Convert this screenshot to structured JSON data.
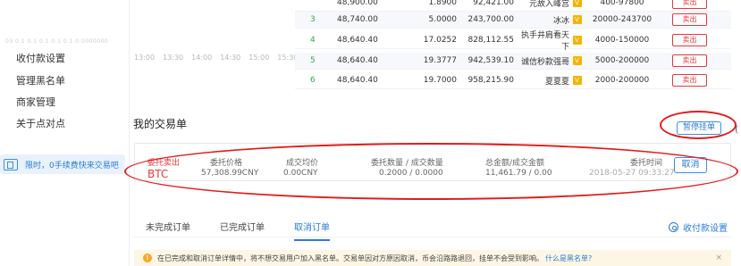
{
  "sidebar": {
    "faint_text": "03 0.1 0.1 0.1 0.1 0.1 0.0000000",
    "items": [
      {
        "label": "收付款设置"
      },
      {
        "label": "管理黑名单"
      },
      {
        "label": "商家管理"
      },
      {
        "label": "关于点对点"
      }
    ],
    "promo": "限时，0手续费快来交易吧"
  },
  "time_axis": [
    "13:00",
    "13:30",
    "14:00",
    "14:30",
    "15:00",
    "15:30"
  ],
  "orders": [
    {
      "no": "",
      "price": "48,900.00",
      "amount": "1.8900",
      "total": "92,421.00",
      "name": "元故入峰宫",
      "badge": "V",
      "range": "400-97800",
      "action": "卖出"
    },
    {
      "no": "3",
      "price": "48,740.00",
      "amount": "5.0000",
      "total": "243,700.00",
      "name": "冰冰",
      "badge": "V",
      "range": "20000-243700",
      "action": "卖出"
    },
    {
      "no": "4",
      "price": "48,640.40",
      "amount": "17.0252",
      "total": "828,112.55",
      "name": "执手井肩看天下",
      "badge": "V",
      "range": "4000-150000",
      "action": "卖出"
    },
    {
      "no": "5",
      "price": "48,640.40",
      "amount": "19.3777",
      "total": "942,539.10",
      "name": "诚信秒款强哥",
      "badge": "V",
      "range": "5000-200000",
      "action": "卖出"
    },
    {
      "no": "6",
      "price": "48,640.40",
      "amount": "19.7000",
      "total": "958,215.90",
      "name": "夏夏夏",
      "badge": "V",
      "range": "2000-200000",
      "action": "卖出"
    }
  ],
  "my_trades": {
    "title": "我的交易单",
    "pause_label": "暂停挂单",
    "headers": {
      "side": "委托卖出",
      "price": "委托价格",
      "avg": "成交均价",
      "qty": "委托数量 / 成交数量",
      "amount": "总金额/成交金额",
      "time": "委托时间"
    },
    "row": {
      "coin": "BTC",
      "price": "57,308.99CNY",
      "avg": "0.00CNY",
      "qty": "0.2000 / 0.0000",
      "amount": "11,461.79 / 0.00",
      "time": "2018-05-27 09:33:27"
    },
    "cancel_label": "取消"
  },
  "tabs": [
    {
      "label": "未完成订单",
      "active": false
    },
    {
      "label": "已完成订单",
      "active": false
    },
    {
      "label": "取消订单",
      "active": true
    }
  ],
  "payment_settings_label": "收付款设置",
  "notice": {
    "text": "在已完成和取消订单详情中，将不想交易用户加入黑名单。交易单因对方原因取消，币会沿路路退回，挂单不会受到影响。",
    "link": "什么是黑名单?",
    "close": "×"
  },
  "colors": {
    "accent": "#2a7bd6",
    "sell_red": "#e4393c",
    "annotation_red": "#e31b1b",
    "badge_gold": "#f5b400",
    "rank_green": "#2aaa55"
  }
}
